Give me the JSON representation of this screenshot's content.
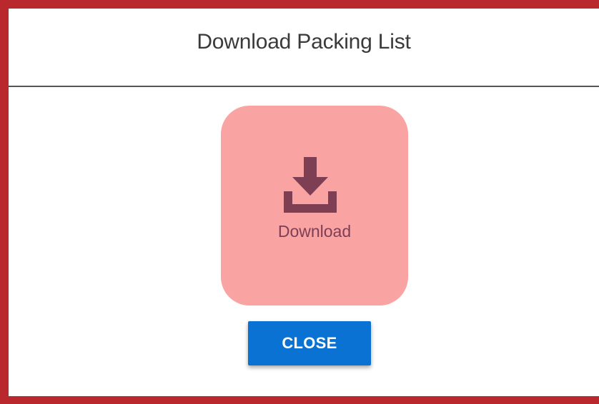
{
  "dialog": {
    "title": "Download Packing List",
    "download": {
      "label": "Download",
      "icon": "download-icon",
      "tile_color": "#f9a3a2",
      "icon_color": "#7e3f55"
    },
    "close_label": "CLOSE",
    "close_color": "#0a72d2",
    "frame_color": "#b8282c"
  }
}
